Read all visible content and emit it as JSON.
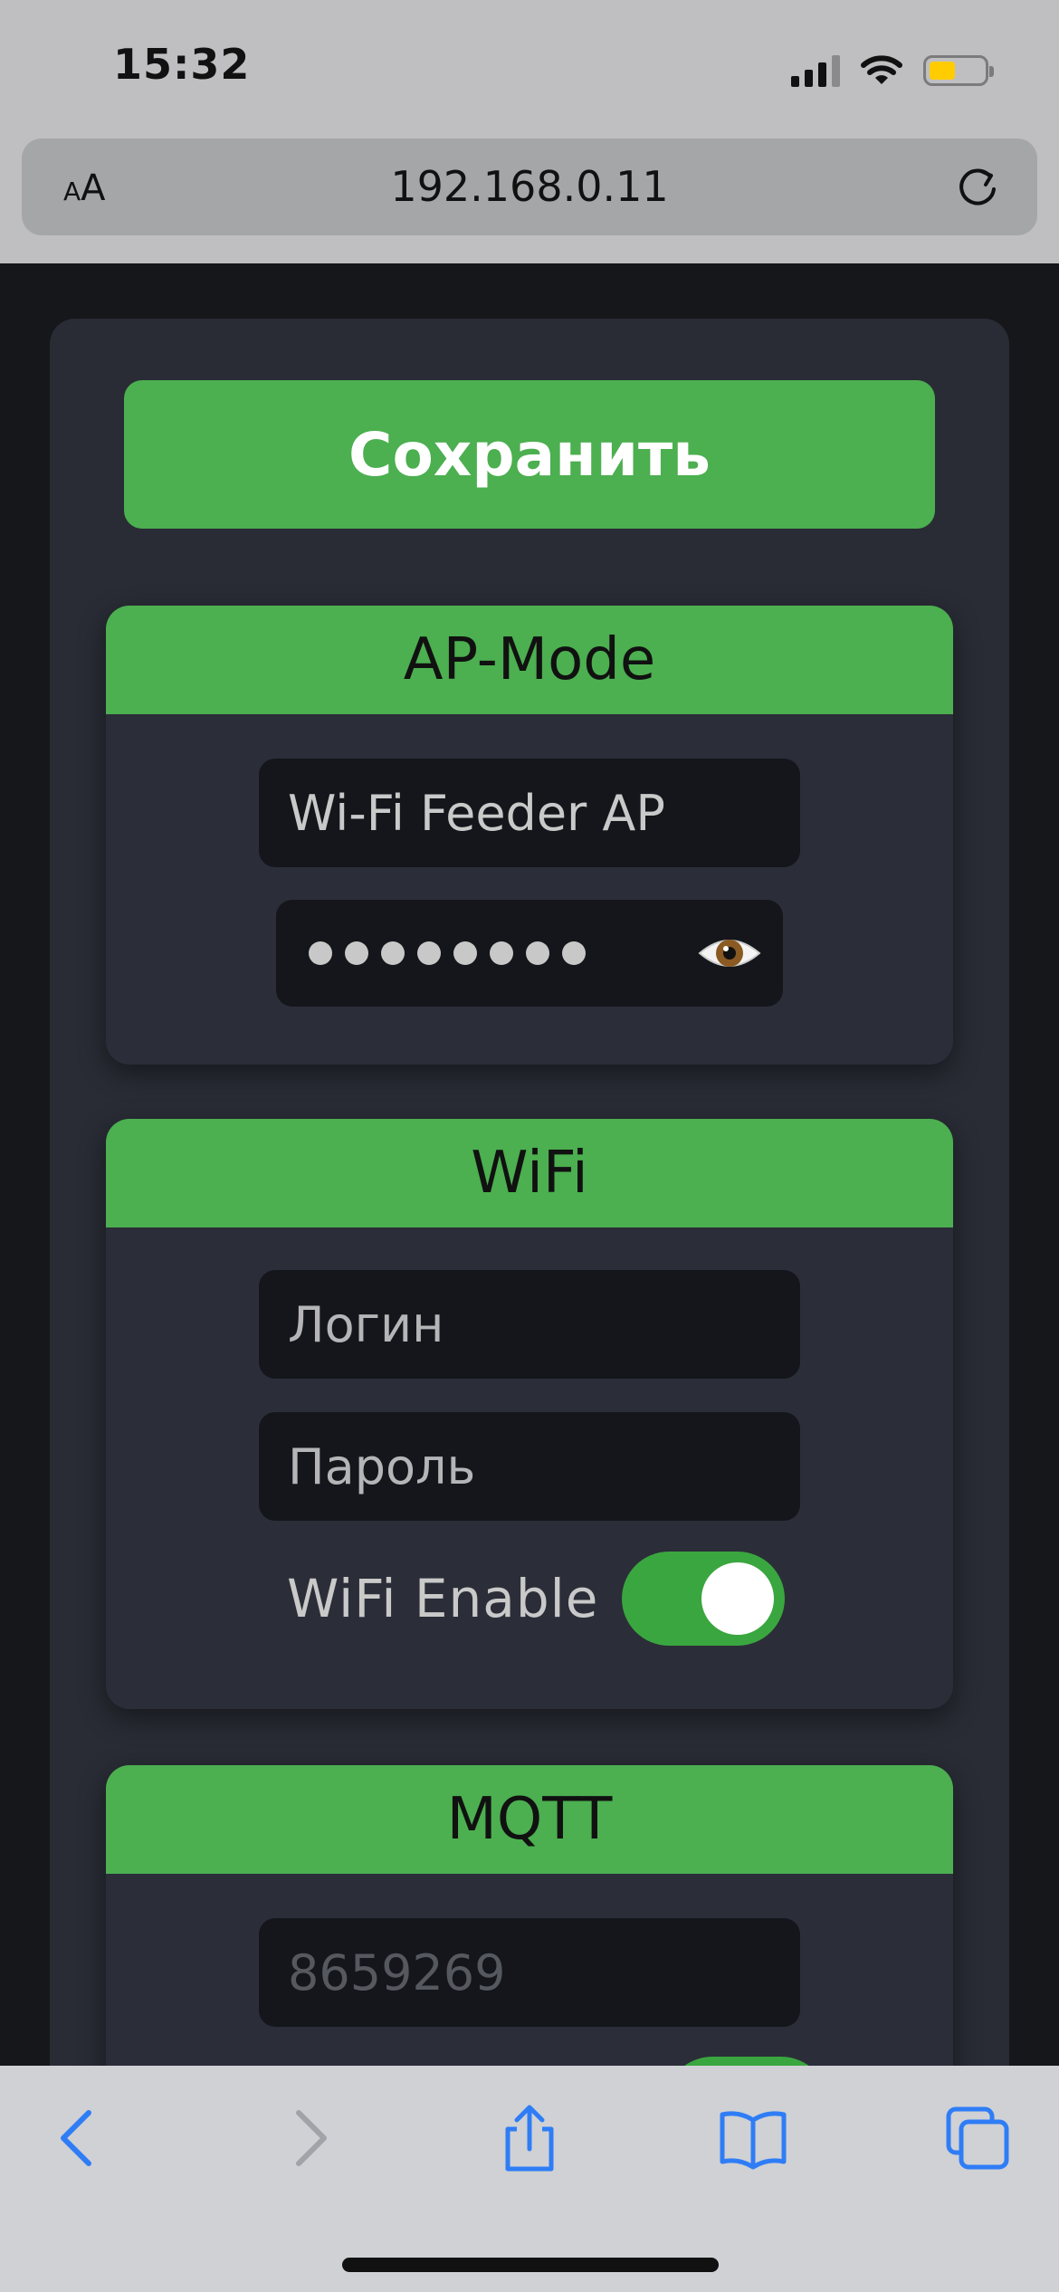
{
  "status_bar": {
    "time": "15:32"
  },
  "address_bar": {
    "text_size_label_small": "A",
    "text_size_label_large": "A",
    "url": "192.168.0.11"
  },
  "page": {
    "save_label": "Сохранить",
    "ap_mode": {
      "title": "AP-Mode",
      "ssid_value": "Wi-Fi Feeder AP",
      "password_masked": "●●●●●●●●"
    },
    "wifi": {
      "title": "WiFi",
      "login_placeholder": "Логин",
      "password_placeholder": "Пароль",
      "enable_label": "WiFi Enable",
      "enabled": true
    },
    "mqtt": {
      "title": "MQTT",
      "field_placeholder": "8659269"
    }
  },
  "colors": {
    "accent_green": "#4caf50",
    "toggle_on": "#3aa63f",
    "card_bg": "#292c35",
    "input_bg": "#14161b",
    "browser_link_blue": "#2f7df6"
  },
  "icons": {
    "reload": "reload-icon",
    "eye": "eye-icon",
    "back": "back-icon",
    "forward": "forward-icon",
    "share": "share-icon",
    "bookmarks": "bookmarks-icon",
    "tabs": "tabs-icon"
  }
}
